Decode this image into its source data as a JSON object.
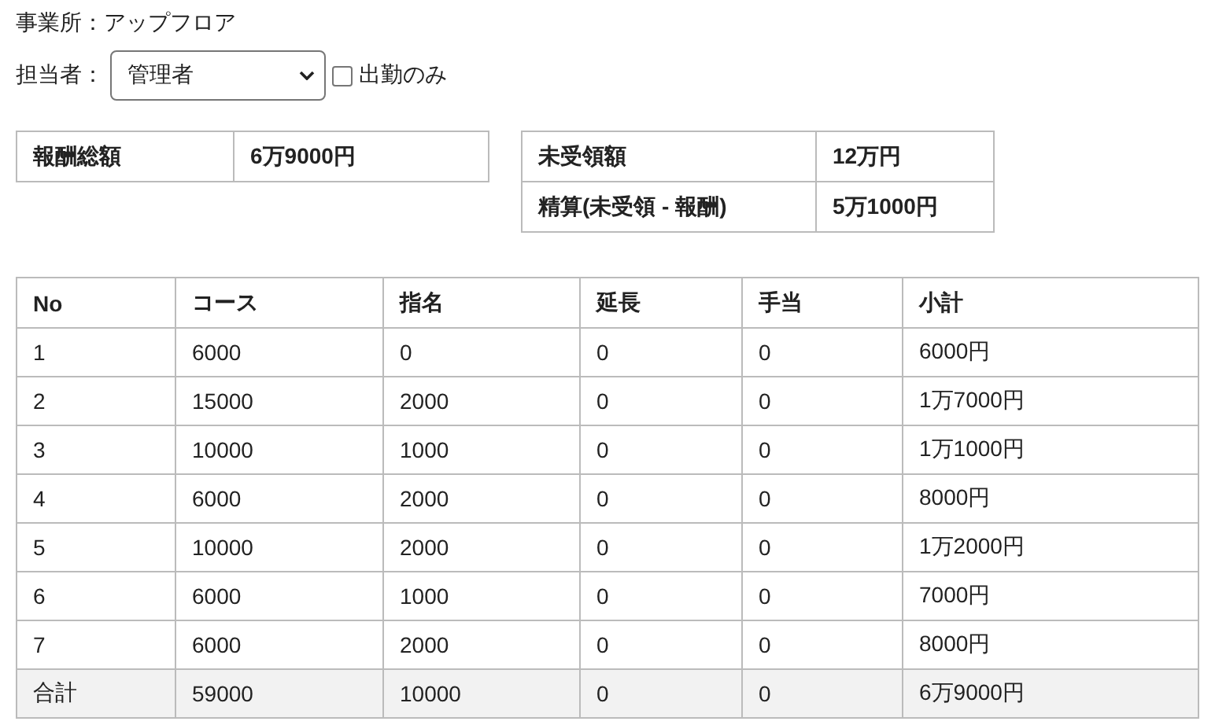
{
  "office": "事業所：アップフロア",
  "staff_filter": {
    "label": "担当者：",
    "value": "管理者"
  },
  "attendance_only": {
    "label": "出勤のみ",
    "checked": false
  },
  "summary_left": [
    {
      "label": "報酬総額",
      "value": "6万9000円"
    }
  ],
  "summary_right": [
    {
      "label": "未受領額",
      "value": "12万円"
    },
    {
      "label": "精算(未受領 - 報酬)",
      "value": "5万1000円"
    }
  ],
  "table": {
    "columns": [
      "No",
      "コース",
      "指名",
      "延長",
      "手当",
      "小計"
    ],
    "rows": [
      [
        "1",
        "6000",
        "0",
        "0",
        "0",
        "6000円"
      ],
      [
        "2",
        "15000",
        "2000",
        "0",
        "0",
        "1万7000円"
      ],
      [
        "3",
        "10000",
        "1000",
        "0",
        "0",
        "1万1000円"
      ],
      [
        "4",
        "6000",
        "2000",
        "0",
        "0",
        "8000円"
      ],
      [
        "5",
        "10000",
        "2000",
        "0",
        "0",
        "1万2000円"
      ],
      [
        "6",
        "6000",
        "1000",
        "0",
        "0",
        "7000円"
      ],
      [
        "7",
        "6000",
        "2000",
        "0",
        "0",
        "8000円"
      ]
    ],
    "total": [
      "合計",
      "59000",
      "10000",
      "0",
      "0",
      "6万9000円"
    ]
  }
}
